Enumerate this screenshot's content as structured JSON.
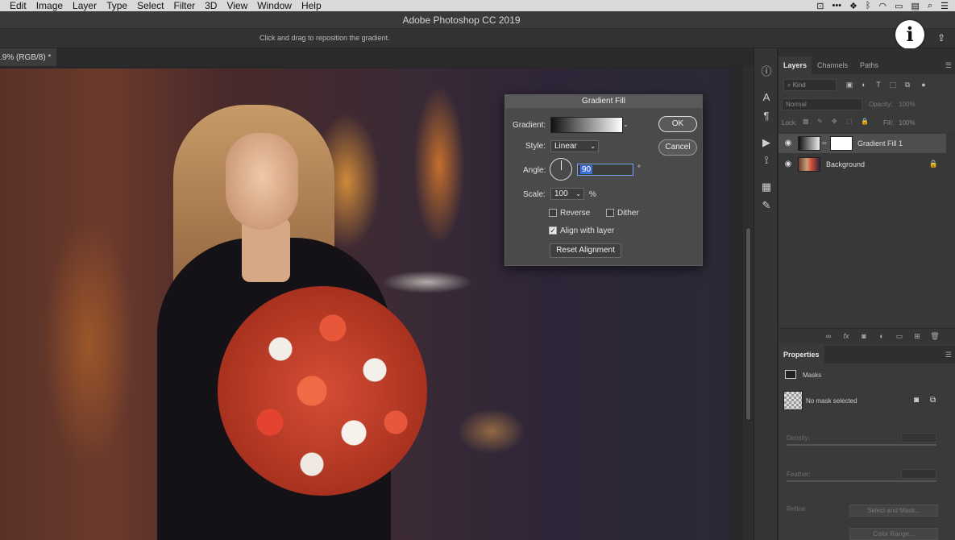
{
  "menubar": {
    "items": [
      "Edit",
      "Image",
      "Layer",
      "Type",
      "Select",
      "Filter",
      "3D",
      "View",
      "Window",
      "Help"
    ]
  },
  "app": {
    "title": "Adobe Photoshop CC 2019",
    "options_hint": "Click and drag to reposition the gradient.",
    "doc_tab": ".9% (RGB/8) *"
  },
  "dialog": {
    "title": "Gradient Fill",
    "gradient_label": "Gradient:",
    "style_label": "Style:",
    "style_value": "Linear",
    "angle_label": "Angle:",
    "angle_value": "90",
    "angle_unit": "°",
    "scale_label": "Scale:",
    "scale_value": "100",
    "scale_unit": "%",
    "reverse_label": "Reverse",
    "dither_label": "Dither",
    "align_label": "Align with layer",
    "reverse_checked": false,
    "dither_checked": false,
    "align_checked": true,
    "reset_label": "Reset Alignment",
    "ok_label": "OK",
    "cancel_label": "Cancel"
  },
  "layers_panel": {
    "tabs": [
      "Layers",
      "Channels",
      "Paths"
    ],
    "kind_placeholder": "Kind",
    "blend_mode": "Normal",
    "opacity_label": "Opacity:",
    "opacity_value": "100%",
    "lock_label": "Lock:",
    "fill_label": "Fill:",
    "fill_value": "100%",
    "layers": [
      {
        "name": "Gradient Fill 1",
        "selected": true
      },
      {
        "name": "Background",
        "selected": false,
        "locked": true
      }
    ]
  },
  "properties_panel": {
    "title": "Properties",
    "section": "Masks",
    "no_mask": "No mask selected",
    "density_label": "Density:",
    "feather_label": "Feather:",
    "refine_label": "Refine:",
    "select_mask_btn": "Select and Mask...",
    "color_range_btn": "Color Range..."
  },
  "overlay": {
    "info_symbol": "i"
  },
  "colors": {
    "accent": "#3e6ed7",
    "panel_bg": "#3a3a3a"
  }
}
